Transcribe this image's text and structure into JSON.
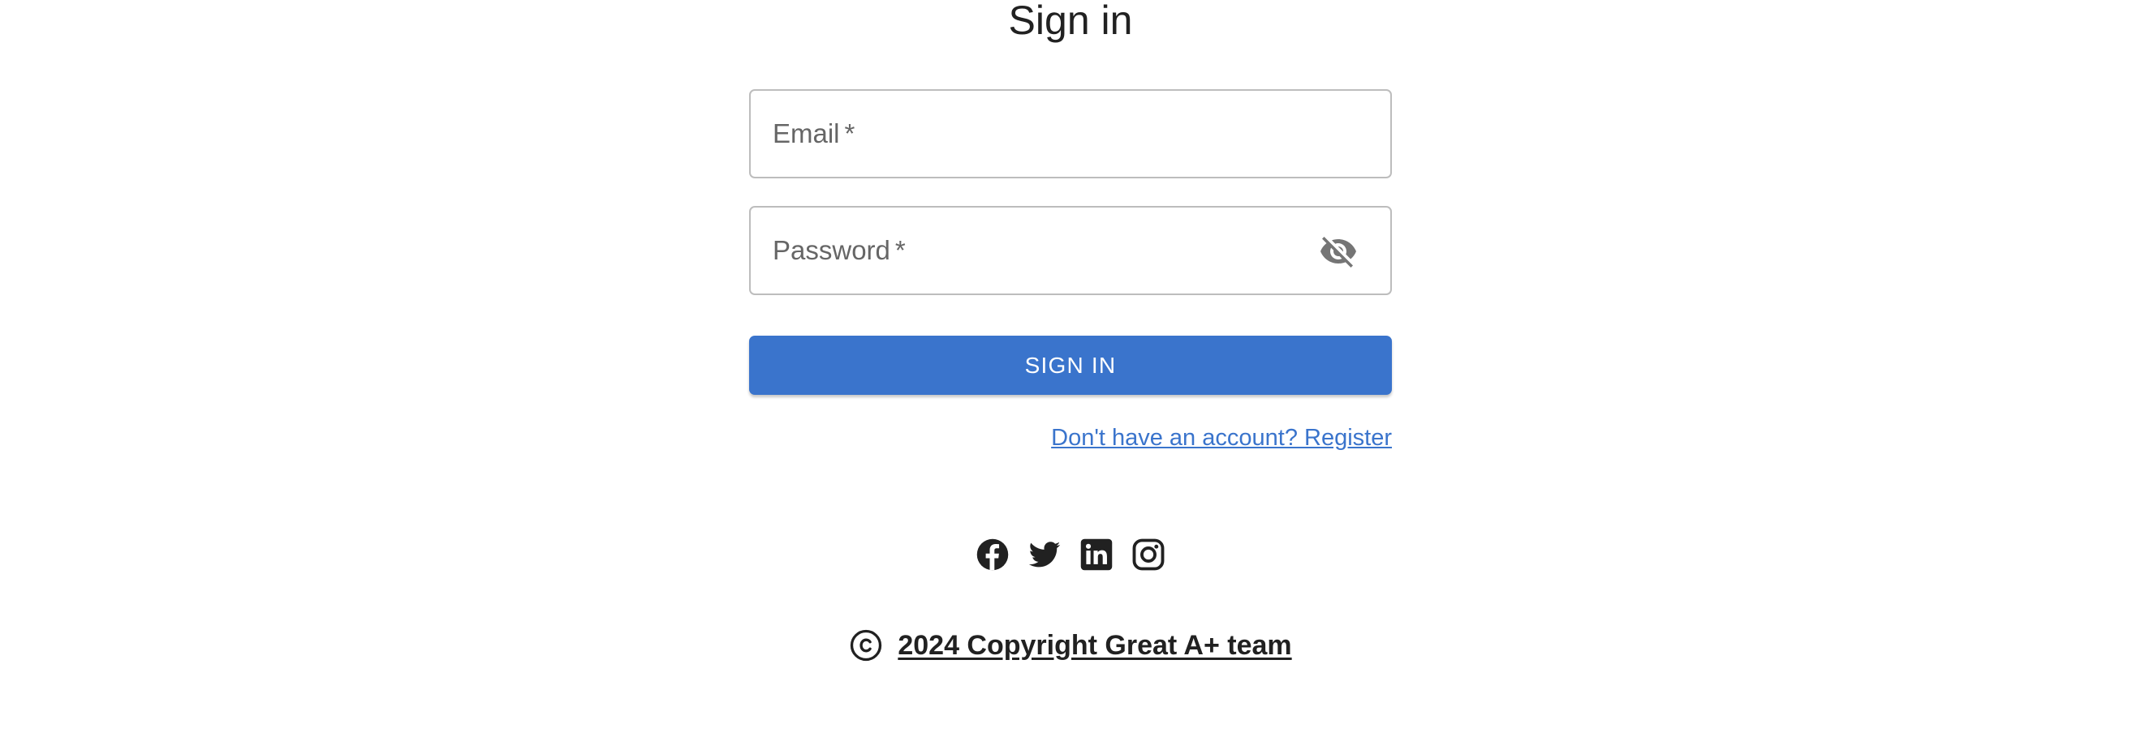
{
  "page": {
    "title": "Sign in"
  },
  "form": {
    "email_label": "Email",
    "password_label": "Password",
    "required_mark": "*",
    "email_value": "",
    "password_value": "",
    "signin_label": "SIGN IN",
    "register_link": "Don't have an account? Register"
  },
  "footer": {
    "social_icons": [
      "facebook-icon",
      "twitter-icon",
      "linkedin-icon",
      "instagram-icon"
    ],
    "copyright_text": "2024 Copyright Great A+ team"
  },
  "colors": {
    "primary": "#3a74cc",
    "text": "#212121",
    "label": "#666666",
    "border": "#bdbdbd",
    "icon": "#757575"
  }
}
